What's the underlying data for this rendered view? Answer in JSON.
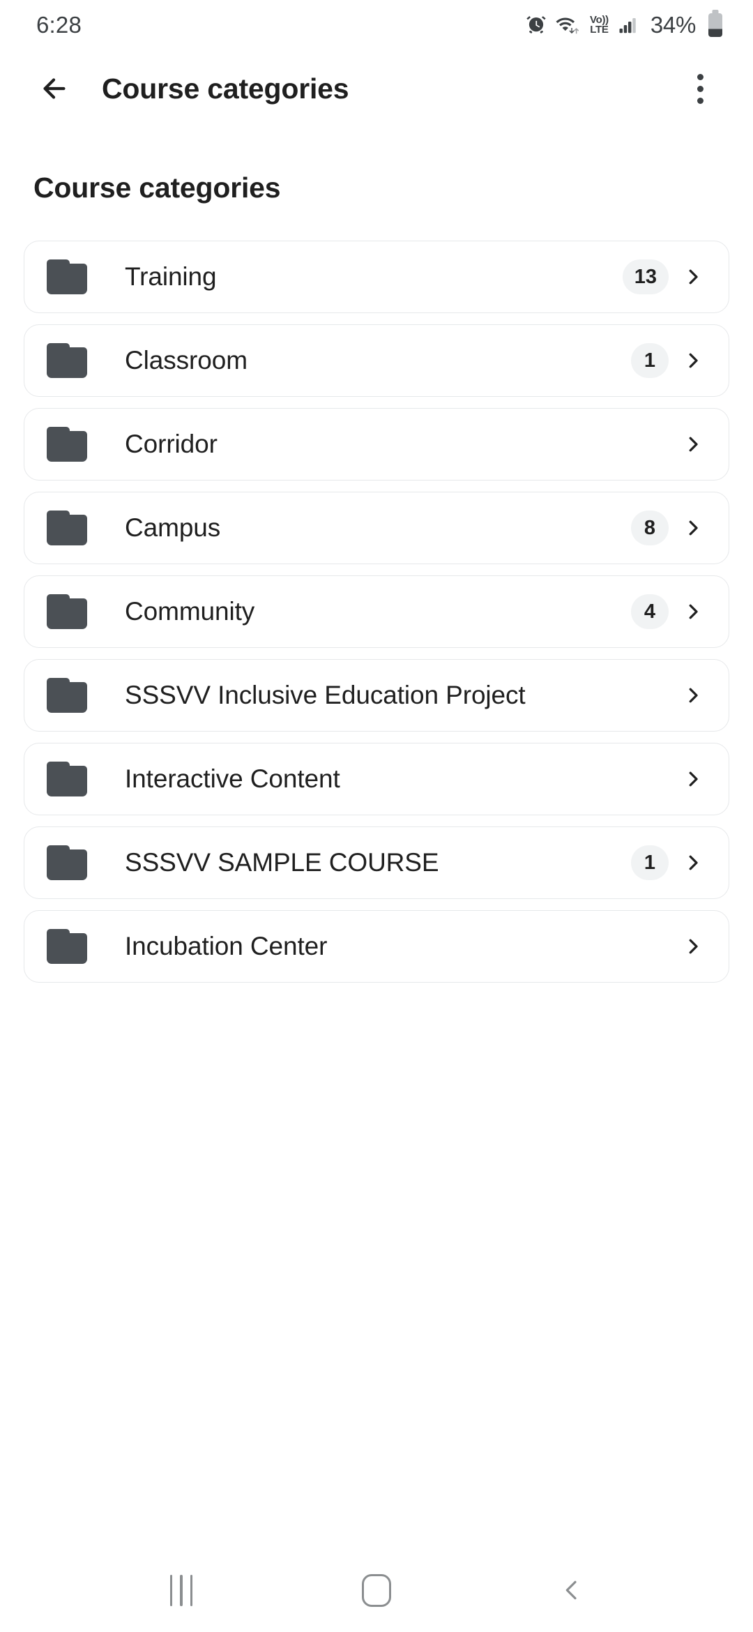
{
  "status_bar": {
    "time": "6:28",
    "battery_percent": "34%",
    "volte_top": "Vo))",
    "volte_bottom": "LTE",
    "icons": [
      "alarm-icon",
      "wifi-icon",
      "volte-icon",
      "signal-icon",
      "battery-icon"
    ]
  },
  "toolbar": {
    "back_icon": "back-arrow-icon",
    "title": "Course categories",
    "overflow_icon": "more-vertical-icon"
  },
  "page": {
    "heading": "Course categories"
  },
  "categories": [
    {
      "name": "Training",
      "count": "13",
      "icon": "folder-icon",
      "chevron": "chevron-right-icon"
    },
    {
      "name": "Classroom",
      "count": "1",
      "icon": "folder-icon",
      "chevron": "chevron-right-icon"
    },
    {
      "name": "Corridor",
      "count": "",
      "icon": "folder-icon",
      "chevron": "chevron-right-icon"
    },
    {
      "name": "Campus",
      "count": "8",
      "icon": "folder-icon",
      "chevron": "chevron-right-icon"
    },
    {
      "name": "Community",
      "count": "4",
      "icon": "folder-icon",
      "chevron": "chevron-right-icon"
    },
    {
      "name": "SSSVV Inclusive Education Project",
      "count": "",
      "icon": "folder-icon",
      "chevron": "chevron-right-icon"
    },
    {
      "name": "Interactive Content",
      "count": "",
      "icon": "folder-icon",
      "chevron": "chevron-right-icon"
    },
    {
      "name": "SSSVV SAMPLE COURSE",
      "count": "1",
      "icon": "folder-icon",
      "chevron": "chevron-right-icon"
    },
    {
      "name": "Incubation Center",
      "count": "",
      "icon": "folder-icon",
      "chevron": "chevron-right-icon"
    }
  ],
  "navigation_bar": {
    "recents_icon": "recents-icon",
    "home_icon": "home-icon",
    "back_icon": "nav-back-icon"
  },
  "colors": {
    "background": "#ffffff",
    "text_primary": "#1f1f1f",
    "text_secondary": "#3c4043",
    "folder": "#4b5055",
    "card_border": "#e6e8ea",
    "badge_bg": "#f1f3f4",
    "nav_icon": "#8b8e90"
  }
}
